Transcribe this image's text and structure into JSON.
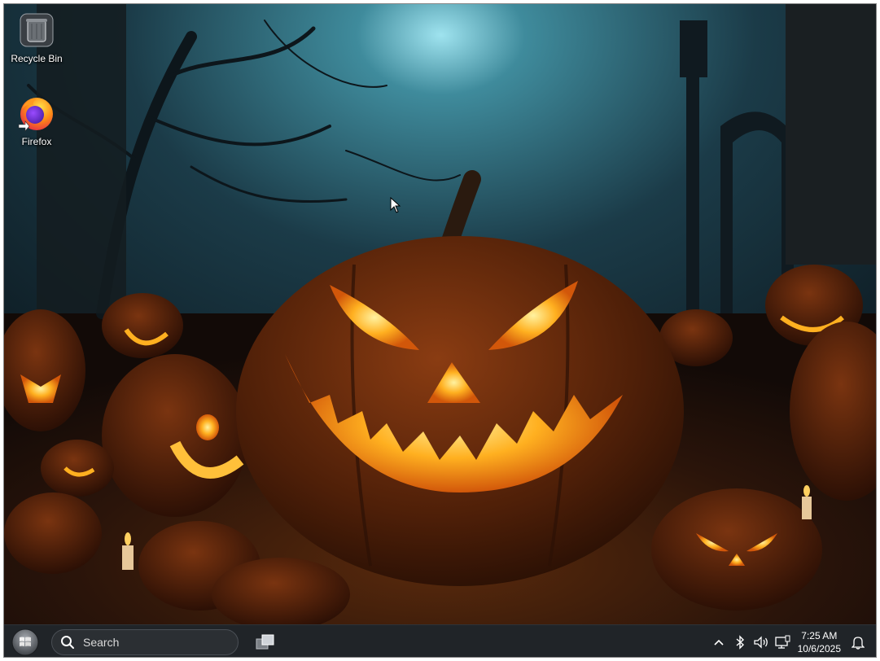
{
  "desktop": {
    "icons": [
      {
        "name": "recycle-bin",
        "label": "Recycle Bin"
      },
      {
        "name": "firefox",
        "label": "Firefox"
      }
    ],
    "wallpaper": "halloween-jack-o-lantern"
  },
  "taskbar": {
    "start_icon": "windows-orb-icon",
    "search_placeholder": "Search",
    "task_view_icon": "task-view-icon",
    "tray": {
      "icons": [
        "chevron-up-icon",
        "bluetooth-icon",
        "volume-icon",
        "network-icon"
      ],
      "time": "7:25 AM",
      "date": "10/6/2025",
      "notification_icon": "bell-icon"
    }
  },
  "colors": {
    "taskbar_bg": "#202428",
    "pumpkin_glow": "#ffb020",
    "sky": "#1d4a5a"
  }
}
